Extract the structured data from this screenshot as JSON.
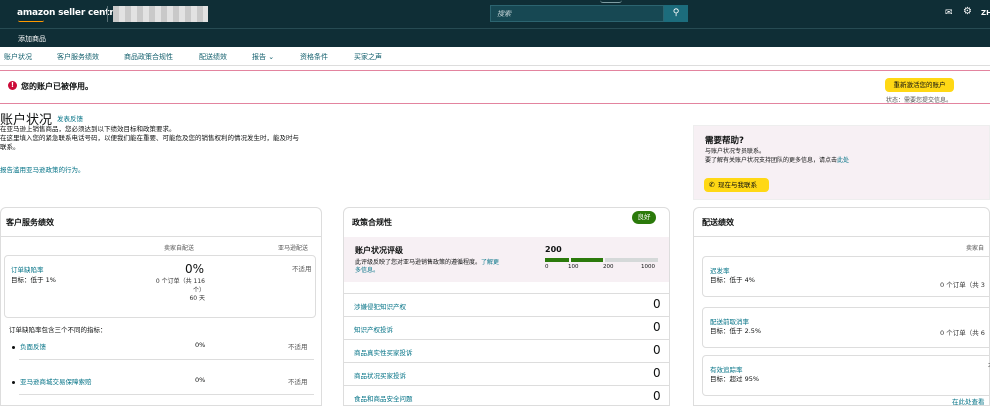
{
  "header": {
    "logo": "amazon seller central",
    "search_placeholder": "搜索",
    "lang": "ZH"
  },
  "subbar": {
    "label": "添加商品"
  },
  "nav": [
    "账户状况",
    "客户服务绩效",
    "商品政策合规性",
    "配送绩效",
    "报告 ⌄",
    "资格条件",
    "买家之声"
  ],
  "alert": {
    "text": "您的账户已被停用。",
    "button": "重新激活您的账户",
    "status": "状态：需要您提交信息。"
  },
  "health": {
    "title": "账户状况",
    "feedback": "发表反馈",
    "desc1": "在亚马逊上销售商品，您必须达到以下绩效目标和政策要求。",
    "desc2": "在这里填入您的紧急联系电话号码，以便我们能在重要、可能危及您的销售权利的情况发生时，能及时与",
    "desc3": "联系。",
    "report": "报告滥用亚马逊政策的行为。"
  },
  "help": {
    "title": "需要帮助?",
    "line1": "与账户状况专员联系。",
    "line2a": "要了解有关账户状况支持团队的更多信息，请点击",
    "line2b": "此处",
    "button": "现在与我联系"
  },
  "customer_service": {
    "title": "客户服务绩效",
    "col_seller": "卖家自配送",
    "col_amazon": "亚马逊配送",
    "odr_name": "订单缺陷率",
    "odr_target": "目标：低于 1%",
    "odr_value": "0%",
    "odr_count1": "0 个订单（共 116",
    "odr_count2": "个）",
    "odr_days": "60 天",
    "odr_na": "不适用",
    "sub_heading": "订单缺陷率包含三个不同的指标：",
    "items": [
      {
        "label": "负面反馈",
        "seller": "0%",
        "amazon": "不适用"
      },
      {
        "label": "亚马逊商城交易保障索赔",
        "seller": "0%",
        "amazon": "不适用"
      }
    ]
  },
  "policy": {
    "title": "政策合规性",
    "badge": "良好",
    "rating_title": "账户状况评级",
    "rating_desc1": "此评级反映了您对亚马逊销售政策的遵循程度。",
    "rating_link1": "了解更",
    "rating_link2": "多信息。",
    "rating_value": "200",
    "scale": [
      "0",
      "100",
      "200",
      "1000"
    ],
    "scale_fraction": 0.2,
    "items": [
      {
        "label": "涉嫌侵犯知识产权",
        "value": "0"
      },
      {
        "label": "知识产权投诉",
        "value": "0"
      },
      {
        "label": "商品真实性买家投诉",
        "value": "0"
      },
      {
        "label": "商品状况买家投诉",
        "value": "0"
      },
      {
        "label": "食品和商品安全问题",
        "value": "0"
      }
    ]
  },
  "shipping": {
    "title": "配送绩效",
    "col": "卖家自",
    "rows": [
      {
        "name": "迟发率",
        "target": "目标：低于 4%",
        "right": "0 个订单（共 3"
      },
      {
        "name": "配送前取消率",
        "target": "目标：低于 2.5%",
        "right": "0 个订单（共 6"
      },
      {
        "name": "有效追踪率",
        "target": "目标：超过 95%",
        "right": "不"
      }
    ],
    "more": "在此处查看"
  }
}
